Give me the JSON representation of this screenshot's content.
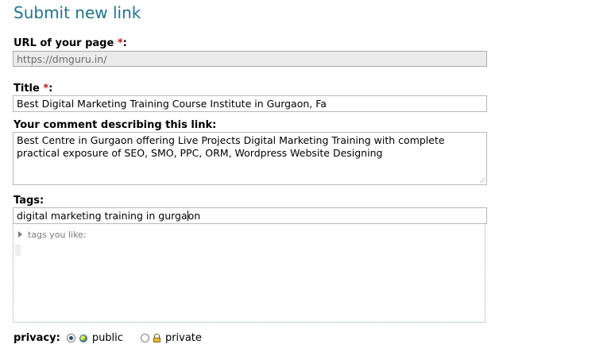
{
  "heading": "Submit new link",
  "url": {
    "label": "URL of your page",
    "required_mark": "*",
    "colon": ":",
    "value": "https://dmguru.in/"
  },
  "title": {
    "label": "Title",
    "required_mark": "*",
    "colon": ":",
    "value": "Best Digital Marketing Training Course Institute in Gurgaon, Fa"
  },
  "comment": {
    "label": "Your comment describing this link:",
    "value": "Best Centre in Gurgaon offering Live Projects Digital Marketing Training with complete practical exposure of SEO, SMO, PPC, ORM, Wordpress Website Designing"
  },
  "tags": {
    "label": "Tags:",
    "value_before_caret": "digital marketing training in gurga",
    "value_after_caret": "on",
    "suggestions_toggle": "tags you like:"
  },
  "privacy": {
    "label": "privacy:",
    "options": [
      {
        "label": "public",
        "checked": true,
        "icon": "globe-icon"
      },
      {
        "label": "private",
        "checked": false,
        "icon": "lock-icon"
      }
    ]
  },
  "colors": {
    "heading": "#22748c",
    "required": "#c0181a"
  }
}
